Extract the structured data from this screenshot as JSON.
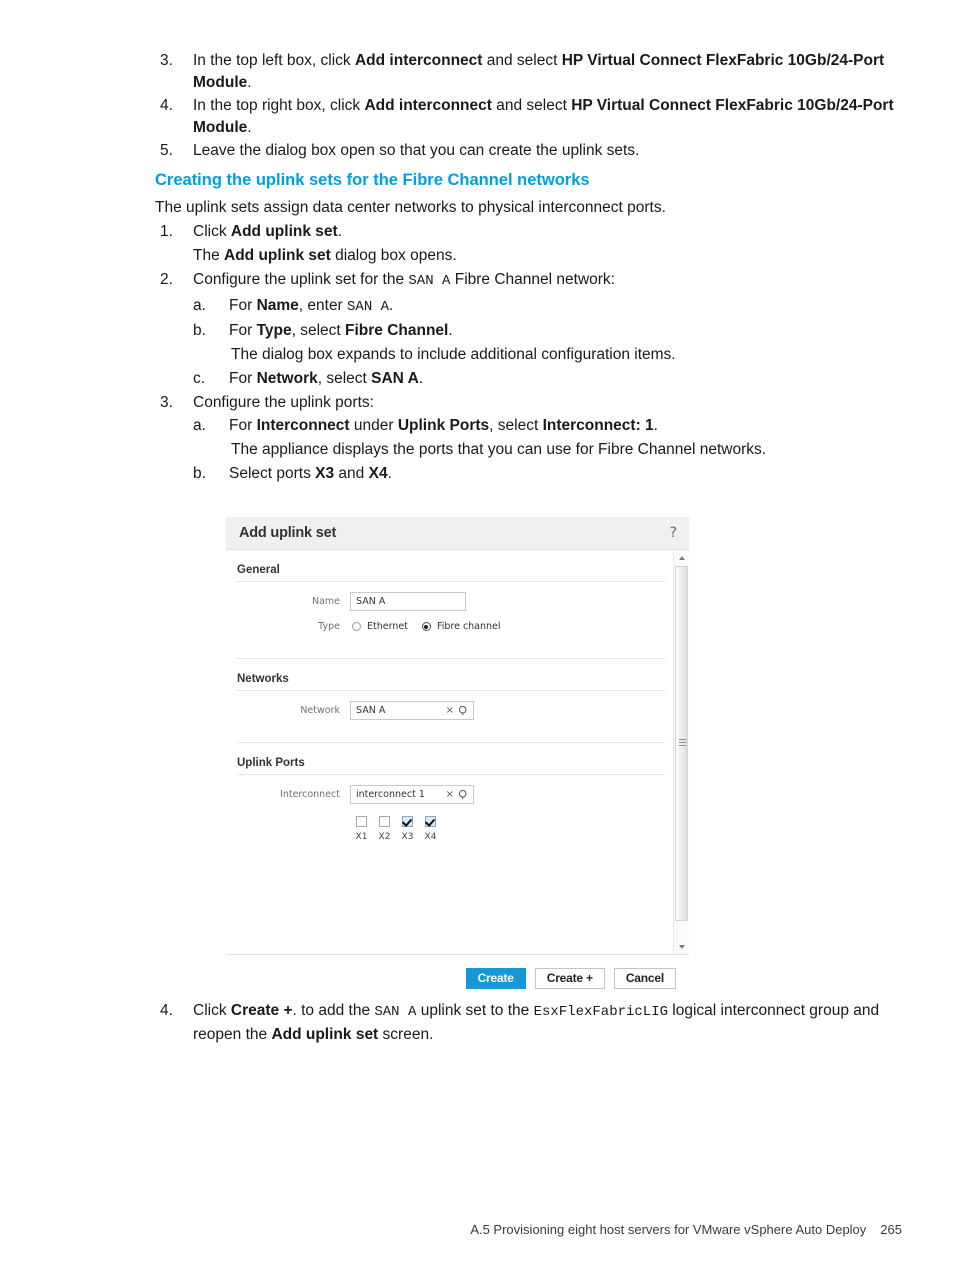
{
  "steps_top": [
    {
      "num": "3.",
      "segments": [
        {
          "t": "In the top left box, click ",
          "s": "n"
        },
        {
          "t": "Add interconnect",
          "s": "b"
        },
        {
          "t": " and select ",
          "s": "n"
        },
        {
          "t": "HP Virtual Connect FlexFabric 10Gb/24-Port Module",
          "s": "b"
        },
        {
          "t": ".",
          "s": "n"
        }
      ]
    },
    {
      "num": "4.",
      "segments": [
        {
          "t": "In the top right box, click ",
          "s": "n"
        },
        {
          "t": "Add interconnect",
          "s": "b"
        },
        {
          "t": " and select ",
          "s": "n"
        },
        {
          "t": "HP Virtual Connect FlexFabric 10Gb/24-Port Module",
          "s": "b"
        },
        {
          "t": ".",
          "s": "n"
        }
      ]
    },
    {
      "num": "5.",
      "segments": [
        {
          "t": "Leave the dialog box open so that you can create the uplink sets.",
          "s": "n"
        }
      ]
    }
  ],
  "section_heading": "Creating the uplink sets for the Fibre Channel networks",
  "intro_paragraph": "The uplink sets assign data center networks to physical interconnect ports.",
  "step1": {
    "num": "1.",
    "segments": [
      {
        "t": "Click ",
        "s": "n"
      },
      {
        "t": "Add uplink set",
        "s": "b"
      },
      {
        "t": ".",
        "s": "n"
      }
    ],
    "followup": [
      {
        "t": "The ",
        "s": "n"
      },
      {
        "t": "Add uplink set",
        "s": "b"
      },
      {
        "t": " dialog box opens.",
        "s": "n"
      }
    ]
  },
  "step2": {
    "num": "2.",
    "segments": [
      {
        "t": "Configure the uplink set for the ",
        "s": "n"
      },
      {
        "t": "SAN A",
        "s": "m"
      },
      {
        "t": " Fibre Channel network:",
        "s": "n"
      }
    ],
    "subs": [
      {
        "num": "a.",
        "segments": [
          {
            "t": "For ",
            "s": "n"
          },
          {
            "t": "Name",
            "s": "b"
          },
          {
            "t": ", enter ",
            "s": "n"
          },
          {
            "t": "SAN A",
            "s": "m"
          },
          {
            "t": ".",
            "s": "n"
          }
        ]
      },
      {
        "num": "b.",
        "segments": [
          {
            "t": "For ",
            "s": "n"
          },
          {
            "t": "Type",
            "s": "b"
          },
          {
            "t": ", select ",
            "s": "n"
          },
          {
            "t": "Fibre Channel",
            "s": "b"
          },
          {
            "t": ".",
            "s": "n"
          }
        ],
        "followup": [
          {
            "t": "The dialog box expands to include additional configuration items.",
            "s": "n"
          }
        ]
      },
      {
        "num": "c.",
        "segments": [
          {
            "t": "For ",
            "s": "n"
          },
          {
            "t": "Network",
            "s": "b"
          },
          {
            "t": ", select ",
            "s": "n"
          },
          {
            "t": "SAN A",
            "s": "b"
          },
          {
            "t": ".",
            "s": "n"
          }
        ]
      }
    ]
  },
  "step3": {
    "num": "3.",
    "segments": [
      {
        "t": "Configure the uplink ports:",
        "s": "n"
      }
    ],
    "subs": [
      {
        "num": "a.",
        "segments": [
          {
            "t": "For ",
            "s": "n"
          },
          {
            "t": "Interconnect",
            "s": "b"
          },
          {
            "t": " under ",
            "s": "n"
          },
          {
            "t": "Uplink Ports",
            "s": "b"
          },
          {
            "t": ", select ",
            "s": "n"
          },
          {
            "t": "Interconnect: 1",
            "s": "b"
          },
          {
            "t": ".",
            "s": "n"
          }
        ],
        "followup": [
          {
            "t": "The appliance displays the ports that you can use for Fibre Channel networks.",
            "s": "n"
          }
        ]
      },
      {
        "num": "b.",
        "segments": [
          {
            "t": "Select ports ",
            "s": "n"
          },
          {
            "t": "X3",
            "s": "b"
          },
          {
            "t": " and ",
            "s": "n"
          },
          {
            "t": "X4",
            "s": "b"
          },
          {
            "t": ".",
            "s": "n"
          }
        ]
      }
    ]
  },
  "step4": {
    "num": "4.",
    "segments": [
      {
        "t": "Click ",
        "s": "n"
      },
      {
        "t": "Create +",
        "s": "b"
      },
      {
        "t": ". to add the ",
        "s": "n"
      },
      {
        "t": "SAN A",
        "s": "m"
      },
      {
        "t": " uplink set to the ",
        "s": "n"
      },
      {
        "t": "EsxFlexFabricLIG",
        "s": "m"
      },
      {
        "t": " logical interconnect group and reopen the ",
        "s": "n"
      },
      {
        "t": "Add uplink set",
        "s": "b"
      },
      {
        "t": " screen.",
        "s": "n"
      }
    ]
  },
  "dialog": {
    "title": "Add uplink set",
    "help_icon": "question-mark-icon",
    "sections": {
      "general": {
        "title": "General",
        "name_label": "Name",
        "name_value": "SAN A",
        "type_label": "Type",
        "type_options": [
          {
            "label": "Ethernet",
            "selected": false
          },
          {
            "label": "Fibre channel",
            "selected": true
          }
        ]
      },
      "networks": {
        "title": "Networks",
        "network_label": "Network",
        "network_value": "SAN A",
        "clear_icon": "close-icon",
        "search_icon": "search-icon"
      },
      "uplink_ports": {
        "title": "Uplink Ports",
        "interconnect_label": "Interconnect",
        "interconnect_value": "interconnect 1",
        "clear_icon": "close-icon",
        "search_icon": "search-icon",
        "ports": [
          {
            "label": "X1",
            "checked": false
          },
          {
            "label": "X2",
            "checked": false
          },
          {
            "label": "X3",
            "checked": true
          },
          {
            "label": "X4",
            "checked": true
          }
        ]
      }
    },
    "buttons": {
      "create": "Create",
      "create_plus": "Create +",
      "cancel": "Cancel"
    },
    "accent_color": "#1798d6"
  },
  "footer": {
    "text": "A.5 Provisioning eight host servers for VMware vSphere Auto Deploy",
    "page_number": "265"
  },
  "colors": {
    "heading_link": "#00a0df",
    "dialog_header_bg": "#f0f0f0",
    "primary_button": "#1798d6",
    "checkbox_checked_bg": "#dbeaf5"
  }
}
